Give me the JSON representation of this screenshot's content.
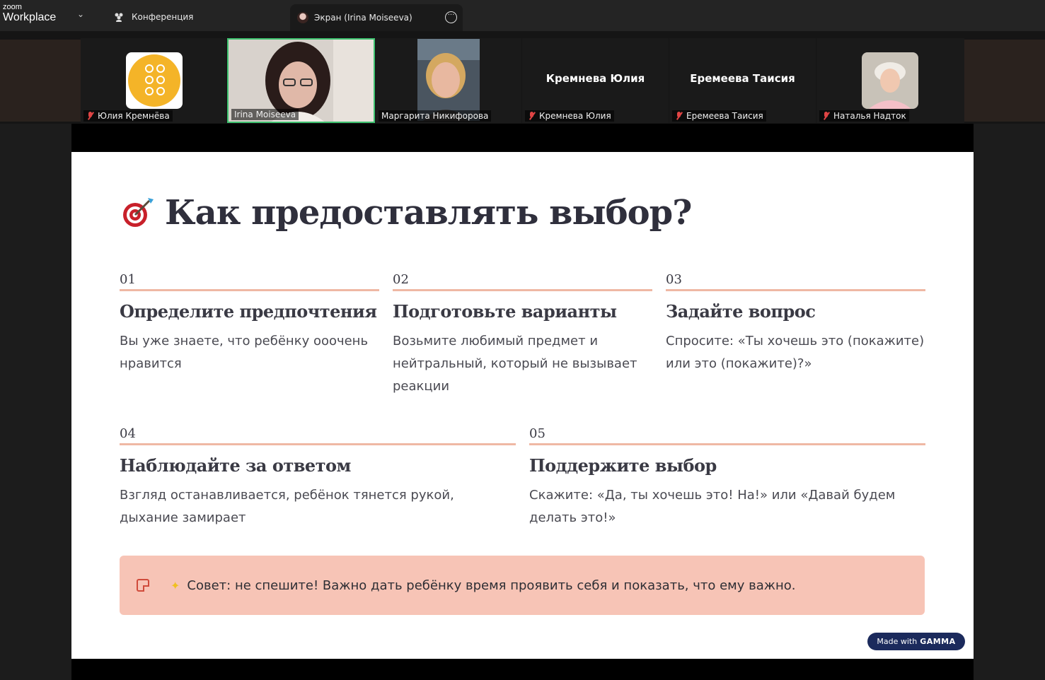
{
  "app": {
    "brand_small": "zoom",
    "brand_big": "Workplace",
    "tab_meeting": "Конференция",
    "tab_screen": "Экран (Irina Moiseeva)"
  },
  "participants": [
    {
      "name": "Юлия Кремнёва",
      "muted": true
    },
    {
      "name": "Irina Moiseeva",
      "muted": false,
      "active_speaker": true
    },
    {
      "name": "Маргарита Никифорова",
      "muted": false
    },
    {
      "name": "Кремнева Юлия",
      "center_name": "Кремнева Юлия",
      "muted": true
    },
    {
      "name": "Еремеева Таисия",
      "center_name": "Еремеева Таисия",
      "muted": true
    },
    {
      "name": "Наталья Надток",
      "muted": true
    }
  ],
  "slide": {
    "title": "Как предоставлять выбор?",
    "title_icon": "target-icon",
    "steps": [
      {
        "num": "01",
        "heading": "Определите предпочтения",
        "text": "Вы уже знаете, что ребёнку ооочень нравится"
      },
      {
        "num": "02",
        "heading": "Подготовьте варианты",
        "text": "Возьмите любимый предмет и нейтральный, который не вызывает реакции"
      },
      {
        "num": "03",
        "heading": "Задайте вопрос",
        "text": "Спросите: «Ты хочешь это (покажите) или это (покажите)?»"
      },
      {
        "num": "04",
        "heading": "Наблюдайте за ответом",
        "text": "Взгляд останавливается, ребёнок тянется рукой, дыхание замирает"
      },
      {
        "num": "05",
        "heading": "Поддержите выбор",
        "text": "Скажите: «Да, ты хочешь это! На!» или «Давай будем делать это!»"
      }
    ],
    "tip": "Совет: не спешите! Важно дать ребёнку время проявить себя и показать, что ему важно.",
    "badge_prefix": "Made with",
    "badge_brand": "GAMMA"
  },
  "colors": {
    "accent_rule": "#efb8a4",
    "tip_bg": "#f7c4b6",
    "active_speaker_border": "#3ec26f",
    "badge_bg": "#1b2a5c"
  }
}
